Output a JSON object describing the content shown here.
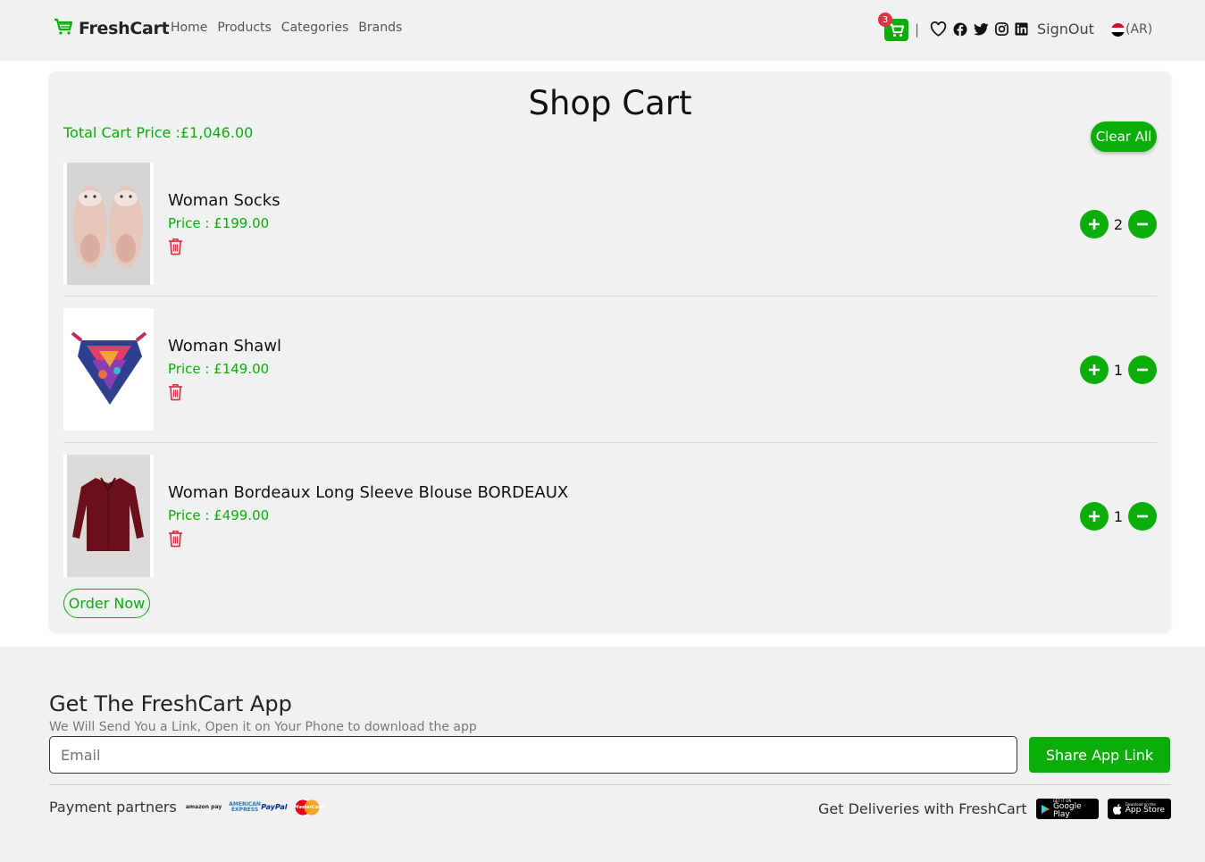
{
  "nav": {
    "brand": "FreshCart",
    "links": [
      "Home",
      "Products",
      "Categories",
      "Brands"
    ],
    "cart_count": "3",
    "separator": "|",
    "signout": "SignOut",
    "lang": "(AR)"
  },
  "cart": {
    "title": "Shop Cart",
    "total_label": "Total Cart Price :£1,046.00",
    "clear_label": "Clear All",
    "items": [
      {
        "name": "Woman Socks",
        "price": "Price : £199.00",
        "qty": "2"
      },
      {
        "name": "Woman Shawl",
        "price": "Price : £149.00",
        "qty": "1"
      },
      {
        "name": "Woman Bordeaux Long Sleeve Blouse BORDEAUX",
        "price": "Price : £499.00",
        "qty": "1"
      }
    ],
    "order_label": "Order Now"
  },
  "footer": {
    "app_title": "Get The FreshCart App",
    "app_sub": "We Will Send You a Link, Open it on Your Phone to download the app",
    "email_placeholder": "Email",
    "share_label": "Share App Link",
    "payment_label": "Payment partners",
    "payment_logos": {
      "amazon": "amazon pay",
      "amex": "AMERICAN EXPRESS",
      "paypal": "PayPal",
      "mastercard": "MasterCard"
    },
    "deliveries_label": "Get Deliveries with FreshCart",
    "google_play": {
      "small": "GET IT ON",
      "big": "Google Play"
    },
    "app_store": {
      "small": "Download on the",
      "big": "App Store"
    }
  },
  "colors": {
    "accent": "#0aad0a",
    "danger": "#dc3545",
    "panel": "#f0f2f2"
  },
  "icons": [
    "cart-logo-icon",
    "shopping-cart-icon",
    "heart-icon",
    "facebook-icon",
    "twitter-icon",
    "instagram-icon",
    "linkedin-icon",
    "egypt-flag-icon",
    "trash-icon",
    "plus-icon",
    "minus-icon"
  ]
}
